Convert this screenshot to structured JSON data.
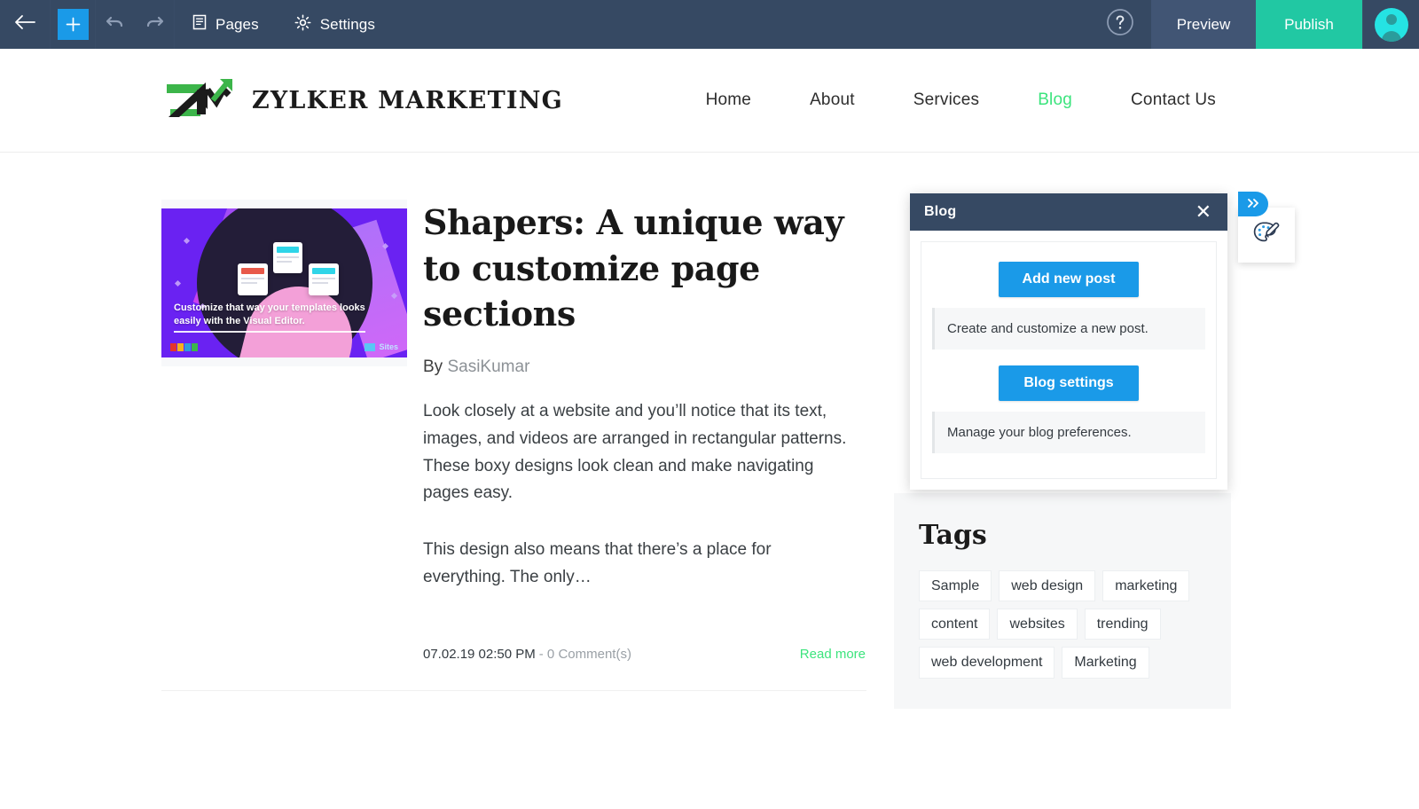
{
  "editor_toolbar": {
    "back_icon": "arrow-left-icon",
    "add_icon": "plus-icon",
    "undo_icon": "undo-arrow-icon",
    "redo_icon": "redo-arrow-icon",
    "pages_label": "Pages",
    "pages_icon": "document-icon",
    "settings_label": "Settings",
    "settings_icon": "gear-icon",
    "help_icon": "question-circle-icon",
    "preview_label": "Preview",
    "publish_label": "Publish",
    "avatar_icon": "user-avatar-icon",
    "bar_color": "#364963",
    "publish_color": "#21c8a3",
    "add_color": "#1a9ae8"
  },
  "site_header": {
    "brand_name": "ZYLKER MARKETING",
    "logo_icon": "zm-arrow-logo-icon",
    "nav": [
      {
        "label": "Home",
        "active": false
      },
      {
        "label": "About",
        "active": false
      },
      {
        "label": "Services",
        "active": false
      },
      {
        "label": "Blog",
        "active": true
      },
      {
        "label": "Contact Us",
        "active": false
      }
    ],
    "active_color": "#3ce47d"
  },
  "post": {
    "thumbnail_caption_line1": "Customize that way your templates looks",
    "thumbnail_caption_line2": "easily with the Visual Editor.",
    "thumbnail_badge": "zoho",
    "thumbnail_product": "Sites",
    "title": "Shapers: A unique way to customize page sections",
    "author_prefix": "By",
    "author_name": "SasiKumar",
    "paragraph_1": "Look closely at a website and you’ll notice that its text, images, and videos are arranged in rectangular patterns. These boxy designs look clean and make navigating pages easy.",
    "paragraph_2": "This design also means that there’s a place for everything. The only…",
    "date": "07.02.19 02:50 PM",
    "comments": "- 0 Comment(s)",
    "read_more": "Read more"
  },
  "blog_panel": {
    "title": "Blog",
    "close_icon": "close-x-icon",
    "add_post_label": "Add new post",
    "add_post_note": "Create and customize a new post.",
    "settings_label": "Blog settings",
    "settings_note": "Manage your blog preferences.",
    "header_color": "#364963",
    "button_color": "#1a9ae8"
  },
  "side_widget": {
    "expand_icon": "double-chevron-right-icon",
    "theme_icon": "palette-brush-icon",
    "tab_color": "#1a9ae8"
  },
  "tags_widget": {
    "title": "Tags",
    "tags": [
      "Sample",
      "web design",
      "marketing",
      "content",
      "websites",
      "trending",
      "web development",
      "Marketing"
    ]
  }
}
